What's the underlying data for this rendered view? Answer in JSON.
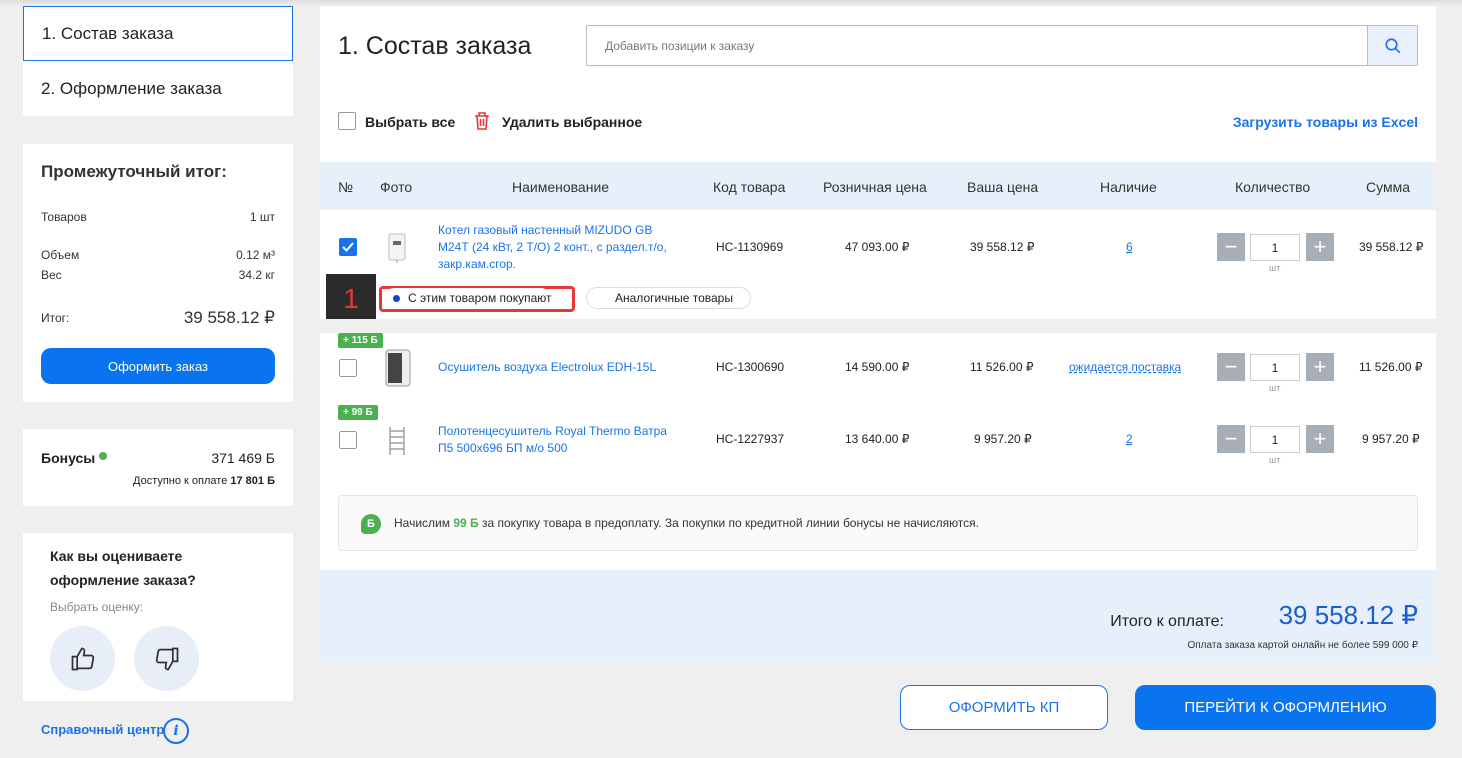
{
  "steps": [
    {
      "label": "1. Состав заказа"
    },
    {
      "label": "2. Оформление заказа"
    }
  ],
  "subtotal": {
    "title": "Промежуточный итог:",
    "items_label": "Товаров",
    "items_value": "1 шт",
    "volume_label": "Объем",
    "volume_value": "0.12 м³",
    "weight_label": "Вес",
    "weight_value": "34.2 кг",
    "total_label": "Итог:",
    "total_value": "39 558.12 ₽",
    "checkout_button": "Оформить заказ"
  },
  "bonus": {
    "label": "Бонусы",
    "value": "371 469 Б",
    "available_label": "Доступно к оплате",
    "available_value": "17 801 Б"
  },
  "rating": {
    "question": "Как вы оцениваете оформление заказа?",
    "hint": "Выбрать оценку:"
  },
  "help": {
    "label": "Справочный центр"
  },
  "main": {
    "title": "1. Состав заказа",
    "search_placeholder": "Добавить позиции к заказу",
    "select_all": "Выбрать все",
    "delete_selected": "Удалить выбранное",
    "upload_excel": "Загрузить товары из Excel"
  },
  "table": {
    "headers": [
      "№",
      "Фото",
      "Наименование",
      "Код товара",
      "Розничная цена",
      "Ваша цена",
      "Наличие",
      "Количество",
      "Сумма"
    ],
    "rows": [
      {
        "checked": true,
        "name": "Котел газовый настенный MIZUDO GB М24Т (24 кВт, 2 Т/О) 2 конт., с раздел.т/о, закр.кам.сгор.",
        "code": "НС-1130969",
        "retail": "47 093.00 ₽",
        "price": "39 558.12 ₽",
        "stock": "6",
        "qty": "1",
        "unit": "шт",
        "sum": "39 558.12 ₽"
      },
      {
        "checked": false,
        "badge": "+ 115 Б",
        "name": "Осушитель воздуха Electrolux EDH-15L",
        "code": "НС-1300690",
        "retail": "14 590.00 ₽",
        "price": "11 526.00 ₽",
        "stock": "ожидается поставка",
        "qty": "1",
        "unit": "шт",
        "sum": "11 526.00 ₽"
      },
      {
        "checked": false,
        "badge": "+ 99 Б",
        "name": "Полотенцесушитель Royal Thermo Ватра П5 500x696 БП м/о 500",
        "code": "НС-1227937",
        "retail": "13 640.00 ₽",
        "price": "9 957.20 ₽",
        "stock": "2",
        "qty": "1",
        "unit": "шт",
        "sum": "9 957.20 ₽"
      }
    ]
  },
  "related": {
    "tab_buy_with": "С этим товаром покупают",
    "tab_similar": "Аналогичные товары",
    "marker": "1"
  },
  "note": {
    "icon": "Б",
    "prefix": "Начислим",
    "amount": "99 Б",
    "suffix": "за покупку товара в предоплату. За покупки по кредитной линии бонусы не начисляются."
  },
  "footer": {
    "total_label": "Итого к оплате:",
    "total_value": "39 558.12 ₽",
    "note": "Оплата заказа картой онлайн не более 599 000 ₽",
    "btn_kp": "ОФОРМИТЬ КП",
    "btn_checkout": "ПЕРЕЙТИ К ОФОРМЛЕНИЮ"
  },
  "colors": {
    "accent": "#0a74f0",
    "bonus_green": "#4caf50",
    "highlight_red": "#e53935"
  }
}
